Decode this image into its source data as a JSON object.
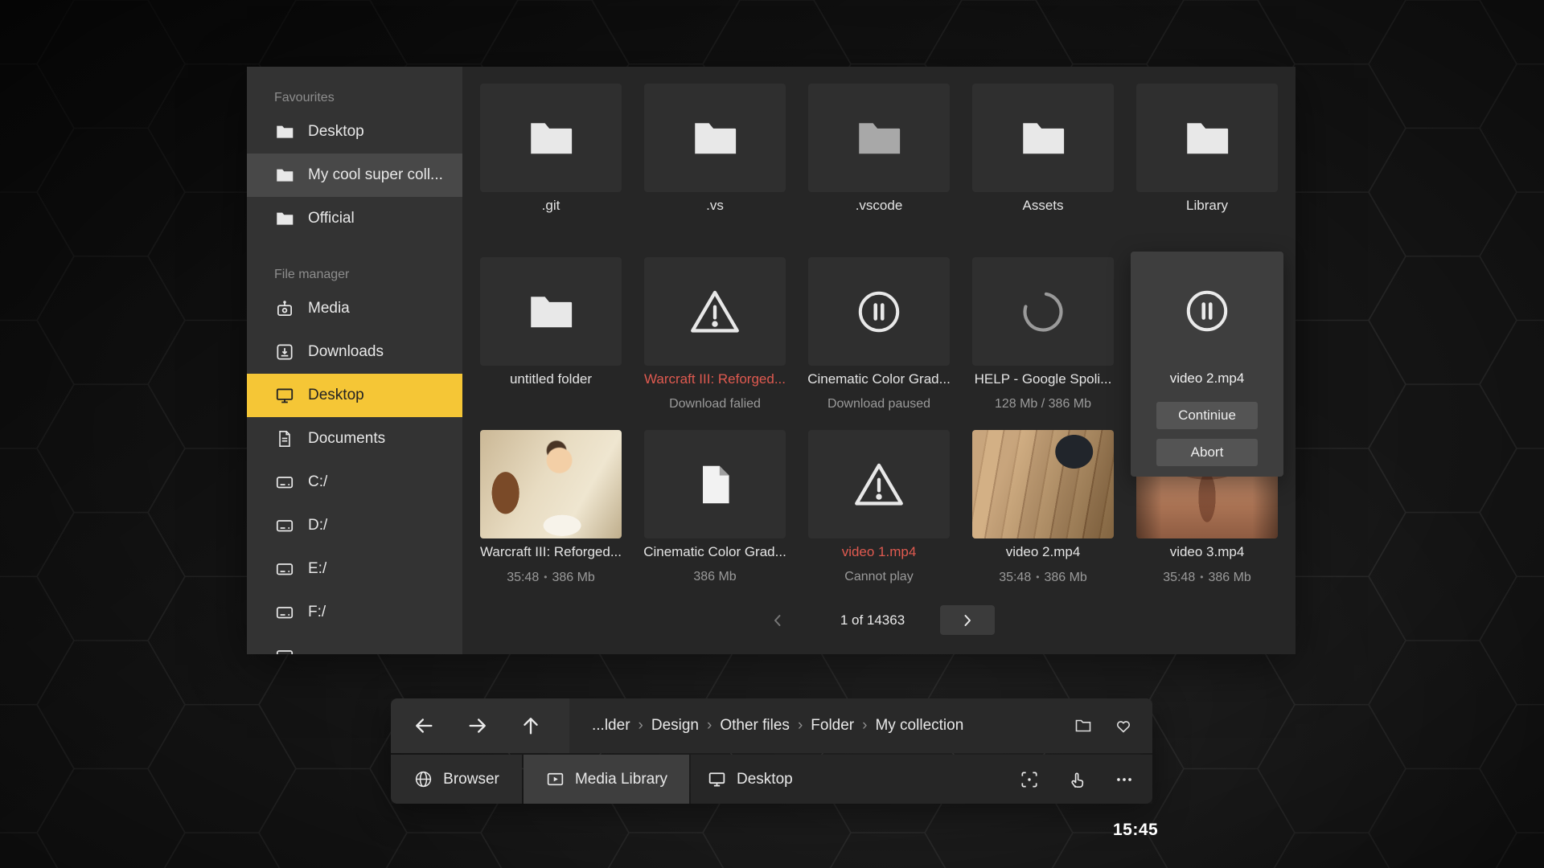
{
  "clock": "15:45",
  "colors": {
    "accent_yellow": "#f5c636",
    "error_red": "#e05a50",
    "selected_gray": "#484848"
  },
  "sidebar": {
    "sections": [
      {
        "label": "Favourites",
        "items": [
          {
            "label": "Desktop",
            "icon": "folder-icon"
          },
          {
            "label": "My cool super coll...",
            "icon": "folder-icon",
            "state": "selected"
          },
          {
            "label": "Official",
            "icon": "folder-icon"
          }
        ]
      },
      {
        "label": "File manager",
        "items": [
          {
            "label": "Media",
            "icon": "media-icon"
          },
          {
            "label": "Downloads",
            "icon": "downloads-icon"
          },
          {
            "label": "Desktop",
            "icon": "monitor-icon",
            "state": "active"
          },
          {
            "label": "Documents",
            "icon": "document-icon"
          },
          {
            "label": "C:/",
            "icon": "drive-icon"
          },
          {
            "label": "D:/",
            "icon": "drive-icon"
          },
          {
            "label": "E:/",
            "icon": "drive-icon"
          },
          {
            "label": "F:/",
            "icon": "drive-icon"
          },
          {
            "label": "",
            "icon": "drive-icon",
            "state": "clipped"
          }
        ]
      }
    ]
  },
  "grid": {
    "meta_separator": "•",
    "tiles": [
      {
        "name": ".git",
        "icon": "folder"
      },
      {
        "name": ".vs",
        "icon": "folder"
      },
      {
        "name": ".vscode",
        "icon": "folder-muted"
      },
      {
        "name": "Assets",
        "icon": "folder"
      },
      {
        "name": "Library",
        "icon": "folder"
      },
      {
        "name": "untitled folder",
        "icon": "folder"
      },
      {
        "name": "Warcraft III: Reforged...",
        "icon": "warning",
        "name_style": "error",
        "status": "Download falied"
      },
      {
        "name": "Cinematic Color Grad...",
        "icon": "pause",
        "status": "Download paused"
      },
      {
        "name": "HELP - Google Spoli...",
        "icon": "spinner",
        "status": "128 Mb / 386 Mb"
      },
      {
        "name": "video 2.mp4",
        "icon": "pause",
        "state": "expanded",
        "buttons": [
          "Continiue",
          "Abort"
        ]
      },
      {
        "name": "Warcraft III: Reforged...",
        "icon": "thumbnail-cartoon",
        "duration": "35:48",
        "size": "386 Mb"
      },
      {
        "name": "Cinematic Color Grad...",
        "icon": "file",
        "size": "386 Mb"
      },
      {
        "name": "video 1.mp4",
        "icon": "warning",
        "name_style": "error",
        "status": "Cannot play"
      },
      {
        "name": "video 2.mp4",
        "icon": "thumbnail-floor",
        "duration": "35:48",
        "size": "386 Mb"
      },
      {
        "name": "video 3.mp4",
        "icon": "thumbnail-torso",
        "duration": "35:48",
        "size": "386 Mb"
      }
    ]
  },
  "pagination": {
    "label": "1 of 14363"
  },
  "toolbar": {
    "breadcrumb": {
      "separator": "›",
      "segments": [
        "...lder",
        "Design",
        "Other files",
        "Folder",
        "My collection"
      ]
    },
    "tabs": [
      {
        "label": "Browser",
        "icon": "globe-icon"
      },
      {
        "label": "Media Library",
        "icon": "media-library-icon"
      },
      {
        "label": "Desktop",
        "icon": "monitor-icon"
      }
    ]
  }
}
